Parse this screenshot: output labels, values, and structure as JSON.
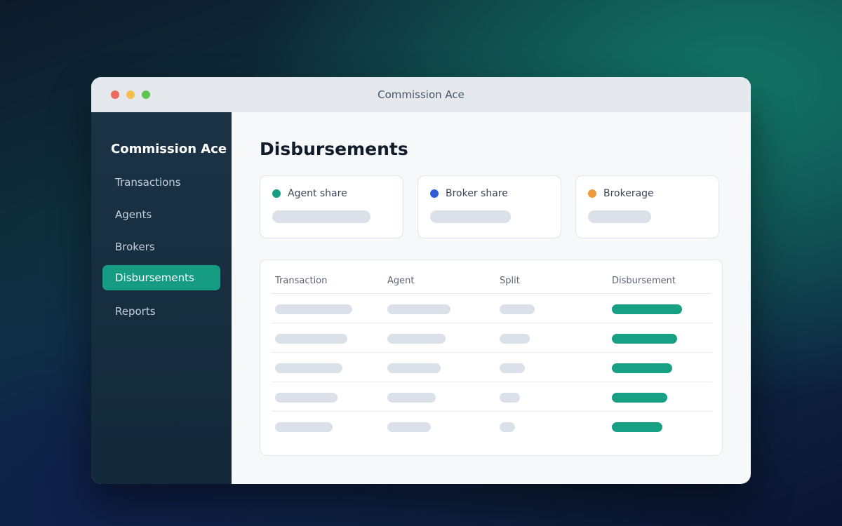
{
  "window": {
    "title": "Commission Ace"
  },
  "sidebar": {
    "brand": "Commission Ace",
    "items": [
      {
        "label": "Transactions",
        "active": false
      },
      {
        "label": "Agents",
        "active": false
      },
      {
        "label": "Brokers",
        "active": false
      },
      {
        "label": "Disbursements",
        "active": true
      },
      {
        "label": "Reports",
        "active": false
      }
    ]
  },
  "main": {
    "title": "Disbursements",
    "cards": [
      {
        "label": "Agent share",
        "color": "#169c82"
      },
      {
        "label": "Broker share",
        "color": "#2f5ed8"
      },
      {
        "label": "Brokerage",
        "color": "#ef9a3d"
      }
    ],
    "table": {
      "columns": [
        "Transaction",
        "Agent",
        "Split",
        "Disbursement"
      ]
    }
  },
  "colors": {
    "accent": "#169c82",
    "sidebar_bg": "#1b3345"
  }
}
